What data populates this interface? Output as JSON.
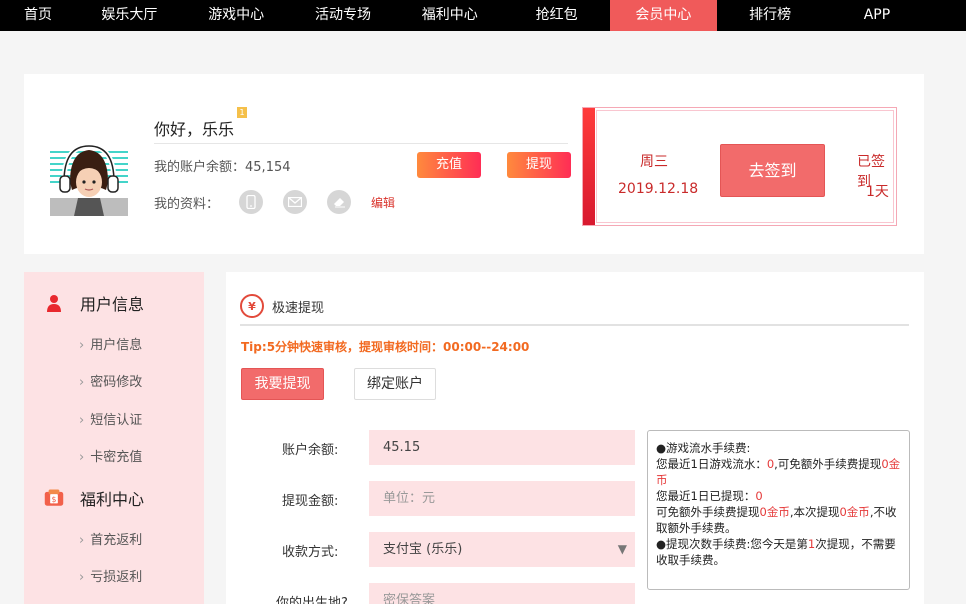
{
  "nav": {
    "items": [
      "首页",
      "娱乐大厅",
      "游戏中心",
      "活动专场",
      "福利中心",
      "抢红包",
      "会员中心",
      "排行榜",
      "APP"
    ],
    "active_index": 6
  },
  "profile": {
    "greeting": "你好，乐乐",
    "level": "1",
    "balance_label": "我的账户余额：",
    "balance_value": "45,154",
    "recharge_label": "充值",
    "withdraw_label": "提现",
    "info_label": "我的资料：",
    "edit_label": "编辑",
    "icons": [
      "phone-icon",
      "mail-icon",
      "eraser-icon"
    ]
  },
  "signin": {
    "weekday": "周三",
    "date": "2019.12.18",
    "button_label": "去签到",
    "signed_label": "已签到",
    "signed_days": "1天"
  },
  "sidebar": {
    "sections": [
      {
        "title": "用户信息",
        "icon": "user-icon",
        "items": [
          "用户信息",
          "密码修改",
          "短信认证",
          "卡密充值"
        ]
      },
      {
        "title": "福利中心",
        "icon": "wallet-icon",
        "items": [
          "首充返利",
          "亏损返利"
        ]
      }
    ]
  },
  "main": {
    "title": "极速提现",
    "tip": "Tip:5分钟快速审核，提现审核时间：00:00--24:00",
    "tabs": [
      "我要提现",
      "绑定账户"
    ],
    "form": {
      "balance_label": "账户余额:",
      "balance_value": "45.15",
      "amount_label": "提现金额:",
      "amount_placeholder": "单位：元",
      "method_label": "收款方式:",
      "method_value": "支付宝 (乐乐)",
      "birthplace_label": "你的出生地?",
      "birthplace_placeholder": "密保答案"
    },
    "notice": {
      "line1": "●游戏流水手续费:",
      "line2a": "您最近1日游戏流水：",
      "line2b": "0",
      "line2c": ",可免额外手续费提现",
      "line2d": "0金币",
      "line3a": "您最近1日已提现：",
      "line3b": "0",
      "line4a": "可免额外手续费提现",
      "line4b": "0金币",
      "line4c": ",本次提现",
      "line4d": "0金币",
      "line4e": ",不收取额外手续费。",
      "line5a": "●提现次数手续费:您今天是第",
      "line5b": "1",
      "line5c": "次提现，不需要收取手续费。"
    }
  },
  "colors": {
    "accent": "#f26b6b",
    "nav_active": "#f05a5a",
    "sidebar_bg": "#fde2e4",
    "field_bg": "#fde2e4",
    "tip": "#f26a21"
  }
}
